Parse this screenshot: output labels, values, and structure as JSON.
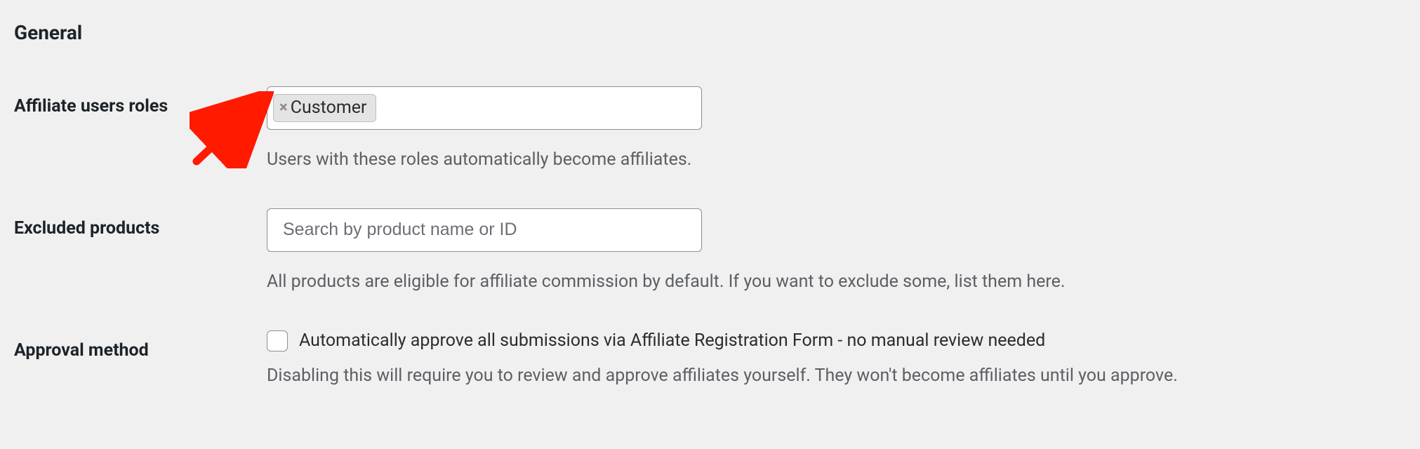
{
  "section_title": "General",
  "fields": {
    "affiliate_roles": {
      "label": "Affiliate users roles",
      "tags": [
        "Customer"
      ],
      "help": "Users with these roles automatically become affiliates."
    },
    "excluded_products": {
      "label": "Excluded products",
      "placeholder": "Search by product name or ID",
      "help": "All products are eligible for affiliate commission by default. If you want to exclude some, list them here."
    },
    "approval_method": {
      "label": "Approval method",
      "checkbox_label": "Automatically approve all submissions via Affiliate Registration Form - no manual review needed",
      "help": "Disabling this will require you to review and approve affiliates yourself. They won't become affiliates until you approve."
    }
  }
}
